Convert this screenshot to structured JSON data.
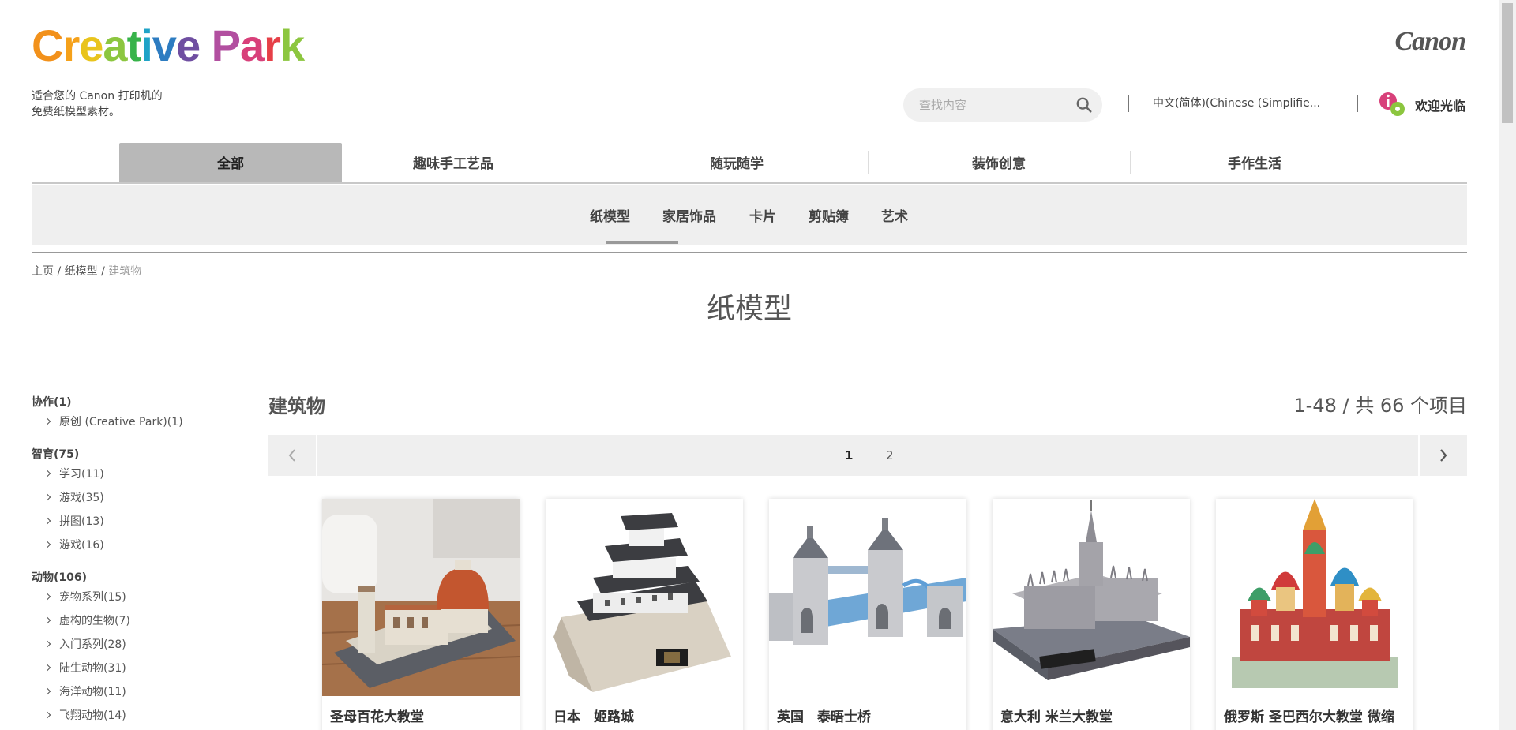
{
  "header": {
    "logo": {
      "letters": [
        "C",
        "r",
        "e",
        "a",
        "t",
        "i",
        "v",
        "e",
        " ",
        "P",
        "a",
        "r",
        "k"
      ]
    },
    "tagline_line1": "适合您的 Canon 打印机的",
    "tagline_line2": "免费纸模型素材。",
    "brand": "Canon",
    "search_placeholder": "查找内容",
    "language": "中文(简体)(Chinese (Simplifie...",
    "welcome": "欢迎光临"
  },
  "logo_colors": [
    "#f2911b",
    "#f5a11a",
    "#e9c41c",
    "#8cc63f",
    "#37b34a",
    "#1fa3c7",
    "#2d7cc1",
    "#6f4ea1",
    " ",
    "#b24fa0",
    "#d8407a",
    "#e63f47",
    "#8cc63f"
  ],
  "main_nav": [
    {
      "label": "全部",
      "active": true
    },
    {
      "label": "趣味手工艺品"
    },
    {
      "label": "随玩随学"
    },
    {
      "label": "装饰创意"
    },
    {
      "label": "手作生活"
    }
  ],
  "sub_nav": [
    "纸模型",
    "家居饰品",
    "卡片",
    "剪贴簿",
    "艺术"
  ],
  "breadcrumb": {
    "home": "主页",
    "sep": " / ",
    "level1": "纸模型",
    "current": "建筑物"
  },
  "page_title": "纸模型",
  "sidebar": {
    "groups": [
      {
        "title": "协作(1)",
        "items": [
          "原创 (Creative Park)(1)"
        ]
      },
      {
        "title": "智育(75)",
        "items": [
          "学习(11)",
          "游戏(35)",
          "拼图(13)",
          "游戏(16)"
        ]
      },
      {
        "title": "动物(106)",
        "items": [
          "宠物系列(15)",
          "虚构的生物(7)",
          "入门系列(28)",
          "陆生动物(31)",
          "海洋动物(11)",
          "飞翔动物(14)"
        ]
      }
    ]
  },
  "results": {
    "section_title": "建筑物",
    "count": "1-48 / 共 66 个项目",
    "pages": [
      "1",
      "2"
    ],
    "current_page": "1"
  },
  "products": [
    {
      "name": "圣母百花大教堂"
    },
    {
      "name": "日本　姬路城"
    },
    {
      "name": "英国　泰晤士桥"
    },
    {
      "name": "意大利 米兰大教堂"
    },
    {
      "name": "俄罗斯 圣巴西尔大教堂 微缩"
    }
  ]
}
